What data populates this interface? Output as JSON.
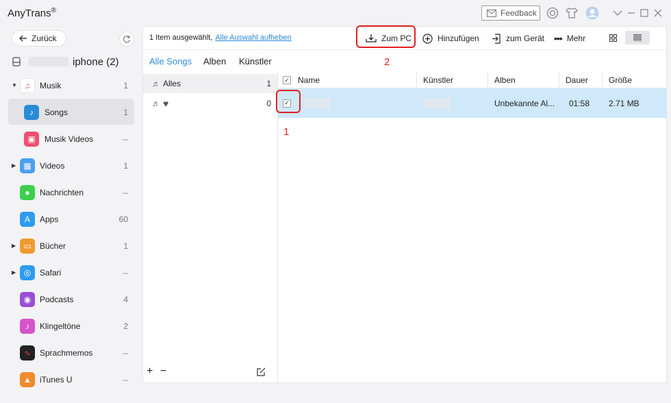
{
  "app": {
    "title": "AnyTrans",
    "reg_mark": "®"
  },
  "titlebar": {
    "feedback_label": "Feedback"
  },
  "sidebar": {
    "back_label": "Zurück",
    "device_name": "iphone (2)",
    "items": [
      {
        "label": "Musik",
        "count": "1",
        "icon": "music-note-icon",
        "color": "#ffffff",
        "expandable": true
      },
      {
        "label": "Songs",
        "count": "1",
        "icon": "music-note-icon",
        "color": "#2a8bd6",
        "active": true
      },
      {
        "label": "Musik Videos",
        "count": "--",
        "icon": "tv-icon",
        "color": "#ef4f72"
      },
      {
        "label": "Videos",
        "count": "1",
        "icon": "film-icon",
        "color": "#4a9ff0",
        "expandable": true
      },
      {
        "label": "Nachrichten",
        "count": "--",
        "icon": "message-icon",
        "color": "#3ccf4e"
      },
      {
        "label": "Apps",
        "count": "60",
        "icon": "appstore-icon",
        "color": "#2d9bf0"
      },
      {
        "label": "Bücher",
        "count": "1",
        "icon": "book-icon",
        "color": "#f09a2d",
        "expandable": true
      },
      {
        "label": "Safari",
        "count": "--",
        "icon": "compass-icon",
        "color": "#2d9bf0",
        "expandable": true
      },
      {
        "label": "Podcasts",
        "count": "4",
        "icon": "podcast-icon",
        "color": "#9a4fd6"
      },
      {
        "label": "Klingeltöne",
        "count": "2",
        "icon": "bell-icon",
        "color": "#d653c9"
      },
      {
        "label": "Sprachmemos",
        "count": "--",
        "icon": "waveform-icon",
        "color": "#222222"
      },
      {
        "label": "iTunes U",
        "count": "--",
        "icon": "graduation-cap-icon",
        "color": "#f08a2d"
      }
    ]
  },
  "toolbar": {
    "selection_text": "1 Item ausgewählt,",
    "deselect_link": "Alle Auswahl aufheben",
    "to_pc": "Zum PC",
    "add": "Hinzufügen",
    "to_device": "zum Gerät",
    "more": "Mehr"
  },
  "tabs": [
    "Alle Songs",
    "Alben",
    "Künstler"
  ],
  "playlists": [
    {
      "label": "Alles",
      "count": "1"
    },
    {
      "label": "",
      "count": "0"
    }
  ],
  "table": {
    "headers": [
      "Name",
      "Künstler",
      "Alben",
      "Dauer",
      "Größe"
    ],
    "rows": [
      {
        "name": "",
        "artist": "",
        "album": "Unbekannte Al...",
        "duration": "01:58",
        "size": "2.71 MB",
        "checked": true
      }
    ]
  },
  "annotations": [
    "1",
    "2"
  ],
  "colors": {
    "accent": "#2a8bd6",
    "selected_row": "#cfe8fa",
    "annotation": "#e02020"
  }
}
